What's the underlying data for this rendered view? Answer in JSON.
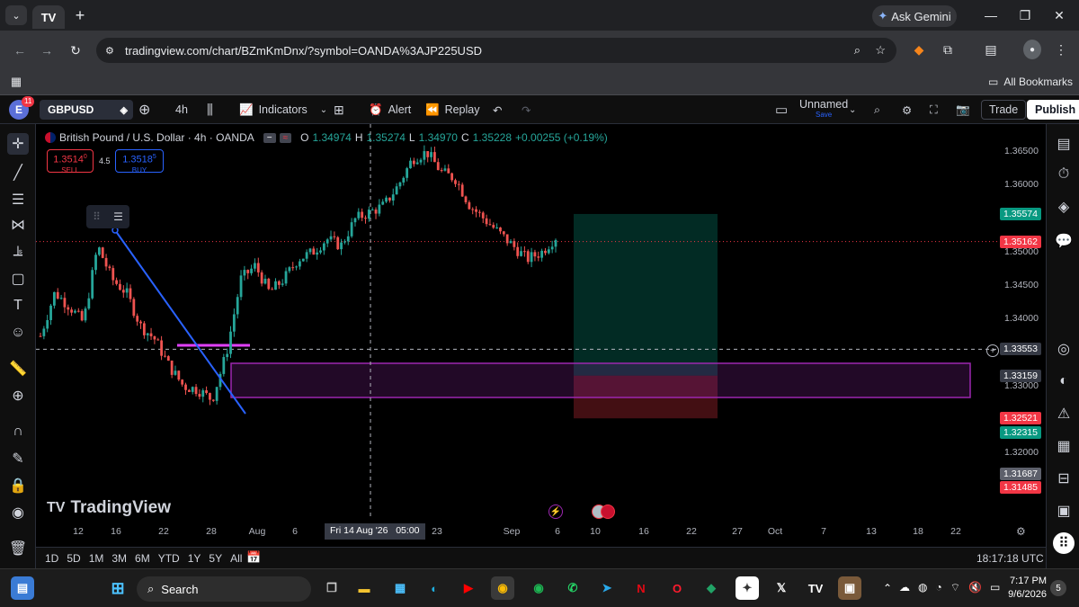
{
  "browser": {
    "gemini_label": "Ask Gemini",
    "url": "tradingview.com/chart/BZmKmDnx/?symbol=OANDA%3AJP225USD",
    "all_bookmarks": "All Bookmarks"
  },
  "toolbar": {
    "notif_count": "11",
    "avatar_letter": "E",
    "symbol": "GBPUSD",
    "interval": "4h",
    "indicators": "Indicators",
    "alert": "Alert",
    "replay": "Replay",
    "layout_name": "Unnamed",
    "save": "Save",
    "trade": "Trade",
    "publish": "Publish"
  },
  "legend": {
    "title": "British Pound / U.S. Dollar · 4h · OANDA",
    "o_label": "O",
    "o": "1.34974",
    "h_label": "H",
    "h": "1.35274",
    "l_label": "L",
    "l": "1.34970",
    "c_label": "C",
    "c": "1.35228",
    "change": "+0.00255 (+0.19%)",
    "sell_price": "1.3514",
    "sell_sup": "0",
    "sell_label": "SELL",
    "spread": "4.5",
    "buy_price": "1.3518",
    "buy_sup": "5",
    "buy_label": "BUY"
  },
  "price_axis": {
    "ticks": [
      "1.36500",
      "1.36000",
      "1.35000",
      "1.34500",
      "1.34000",
      "1.33000",
      "1.32000"
    ],
    "labels": [
      {
        "value": "1.35574",
        "color": "#089981"
      },
      {
        "value": "1.35162",
        "color": "#f23645"
      },
      {
        "value": "1.33553",
        "color": "#363a45"
      },
      {
        "value": "1.33159",
        "color": "#363a45"
      },
      {
        "value": "1.32521",
        "color": "#f23645"
      },
      {
        "value": "1.32315",
        "color": "#089981"
      },
      {
        "value": "1.31687",
        "color": "#5d606b"
      },
      {
        "value": "1.31485",
        "color": "#f23645"
      }
    ]
  },
  "time_axis": {
    "ticks": [
      "12",
      "16",
      "22",
      "28",
      "Aug",
      "6",
      "23",
      "Sep",
      "6",
      "10",
      "16",
      "22",
      "27",
      "Oct",
      "7",
      "13",
      "18",
      "22"
    ],
    "crosshair_label": "Fri 14 Aug '26   05:00"
  },
  "watermark": "TradingView",
  "bottom": {
    "ranges": [
      "1D",
      "5D",
      "1M",
      "3M",
      "6M",
      "YTD",
      "1Y",
      "5Y",
      "All"
    ],
    "clock": "18:17:18 UTC"
  },
  "taskbar": {
    "search": "Search",
    "time": "7:17 PM",
    "date": "9/6/2026",
    "notif": "5"
  },
  "chart_data": {
    "type": "candlestick",
    "symbol": "GBPUSD",
    "interval": "4h",
    "y_range": [
      1.3115,
      1.369
    ],
    "x_labels": [
      "12",
      "16",
      "22",
      "28",
      "Aug",
      "6",
      "23",
      "Sep",
      "6"
    ],
    "close_path": [
      1.3375,
      1.344,
      1.342,
      1.3395,
      1.351,
      1.346,
      1.344,
      1.339,
      1.337,
      1.333,
      1.33,
      1.3295,
      1.328,
      1.335,
      1.346,
      1.348,
      1.344,
      1.346,
      1.349,
      1.35,
      1.352,
      1.351,
      1.355,
      1.356,
      1.357,
      1.36,
      1.364,
      1.365,
      1.362,
      1.361,
      1.357,
      1.355,
      1.353,
      1.351,
      1.349,
      1.35,
      1.3523
    ],
    "current_price": 1.35162,
    "crosshair_price": 1.33553,
    "long_position": {
      "target": 1.35574,
      "entry": 1.33159,
      "stop": 1.32521
    },
    "demand_zone": [
      1.328,
      1.3335
    ]
  }
}
